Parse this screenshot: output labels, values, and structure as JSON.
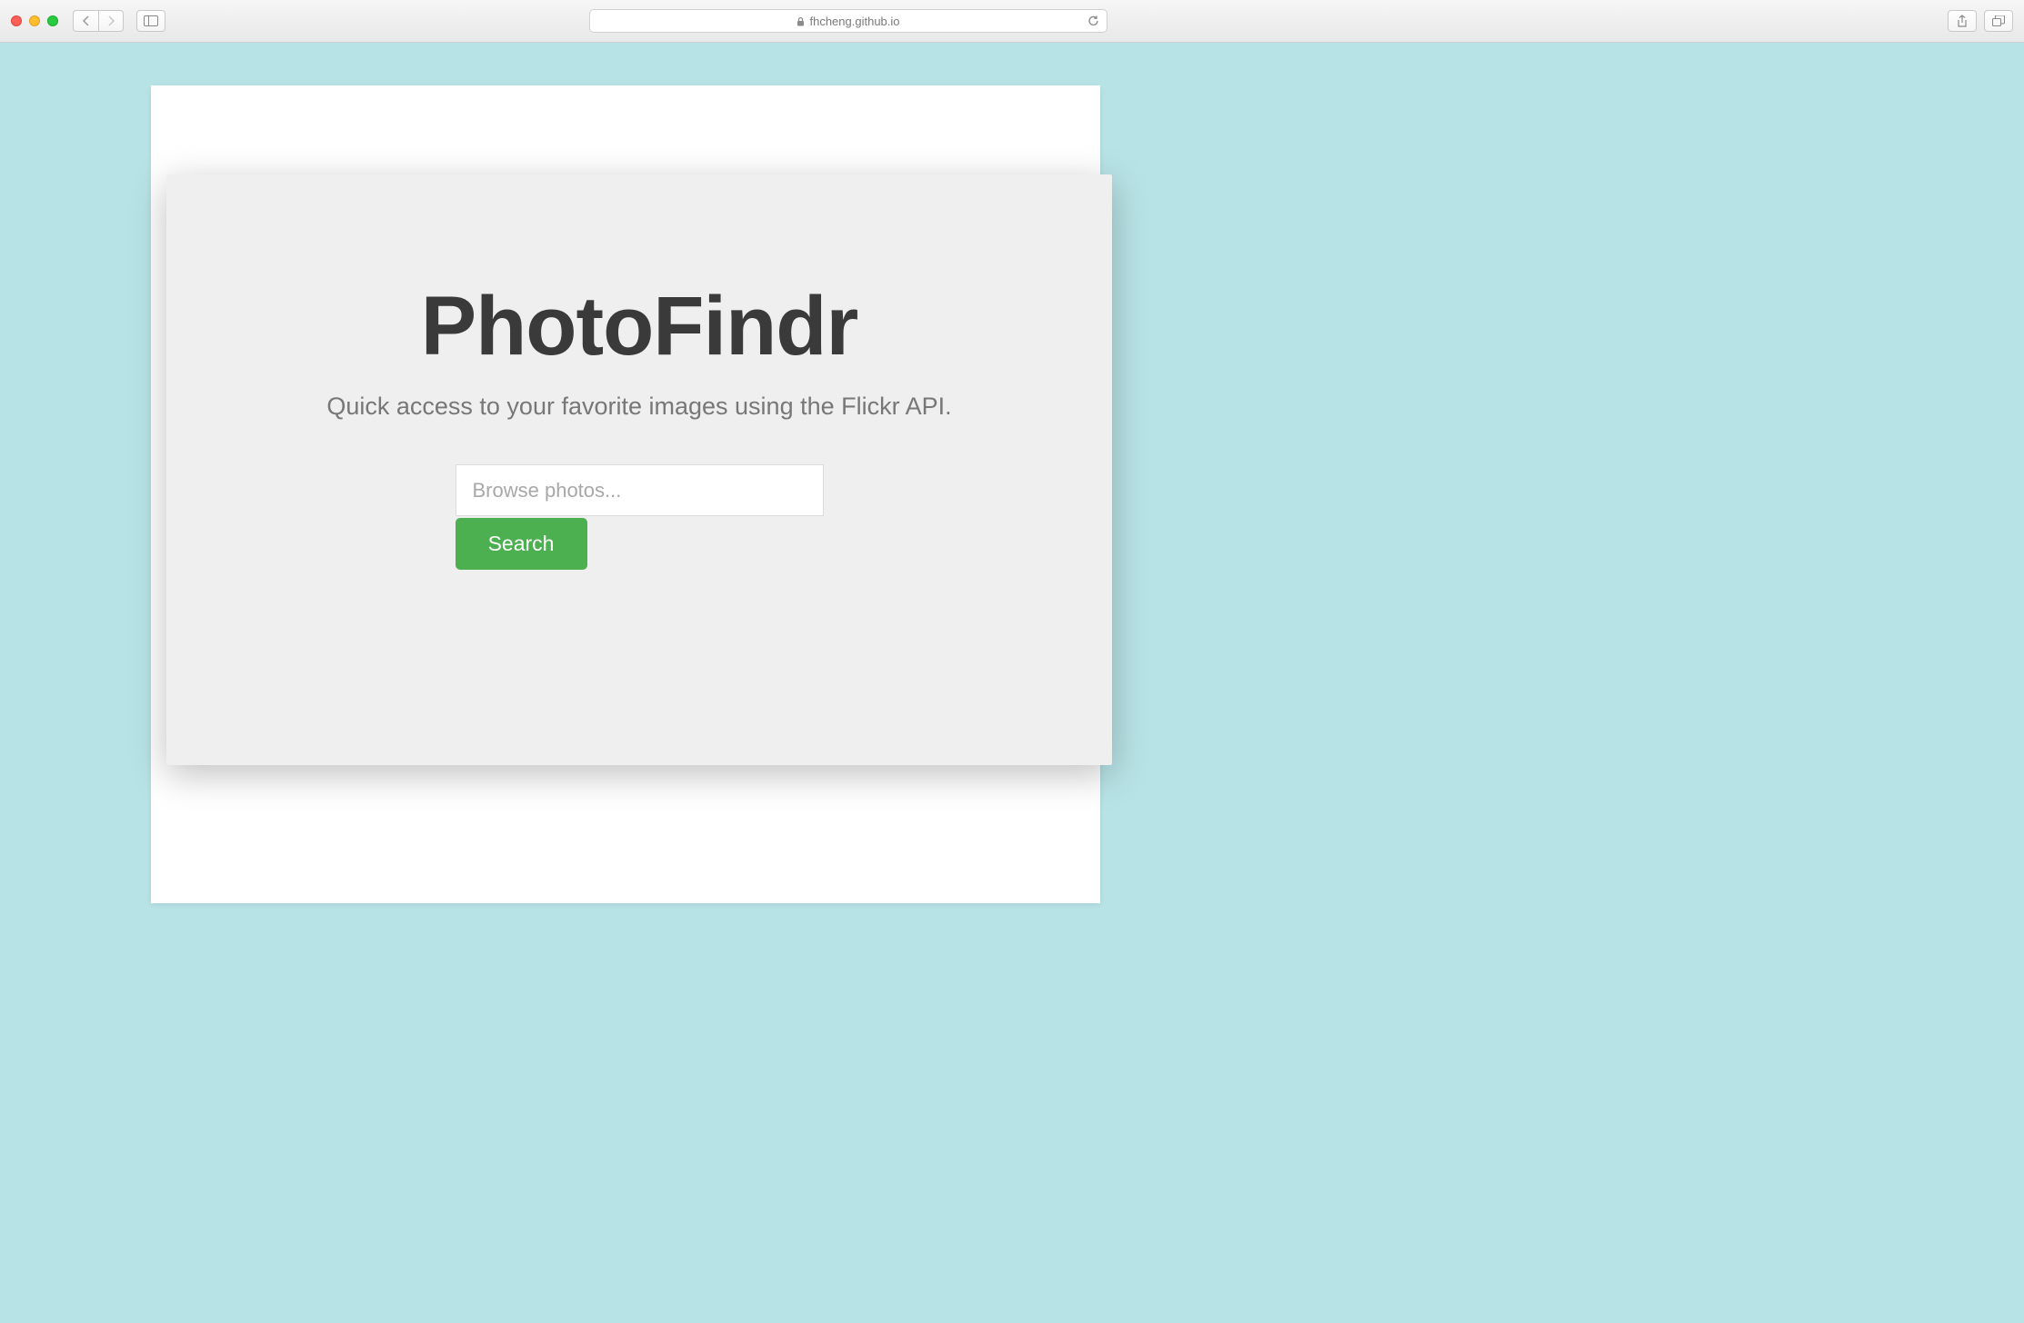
{
  "browser": {
    "url_display": "fhcheng.github.io"
  },
  "hero": {
    "title": "PhotoFindr",
    "subtitle": "Quick access to your favorite images using the Flickr API.",
    "search_placeholder": "Browse photos...",
    "search_value": "",
    "search_button_label": "Search"
  },
  "colors": {
    "page_bg": "#b8e3e6",
    "hero_bg": "#efefef",
    "title_color": "#3a3a3a",
    "subtitle_color": "#777777",
    "button_bg": "#4caf50"
  }
}
